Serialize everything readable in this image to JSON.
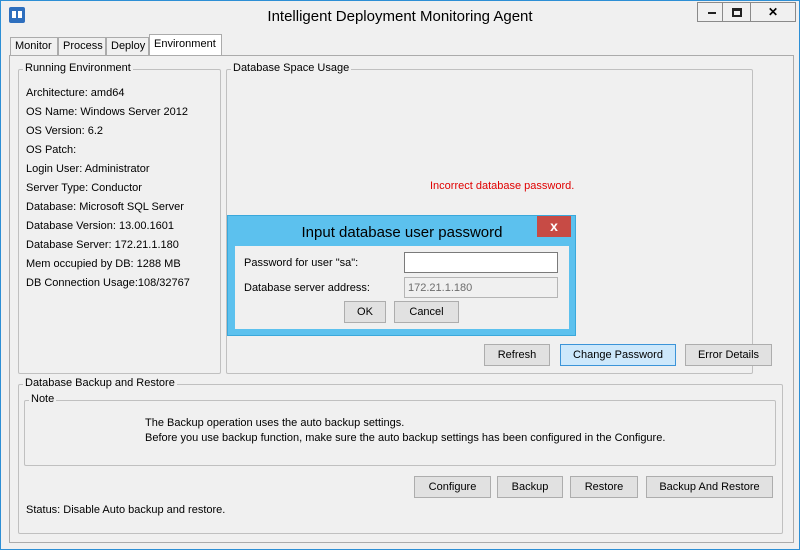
{
  "window": {
    "title": "Intelligent Deployment Monitoring Agent"
  },
  "tabs": [
    {
      "label": "Monitor"
    },
    {
      "label": "Process"
    },
    {
      "label": "Deploy"
    },
    {
      "label": "Environment",
      "active": true
    }
  ],
  "running_env": {
    "title": "Running Environment",
    "lines": [
      "Architecture: amd64",
      "OS Name: Windows Server 2012",
      "OS Version: 6.2",
      "OS Patch:",
      "Login User: Administrator",
      "Server Type: Conductor",
      "Database: Microsoft SQL Server",
      "Database Version: 13.00.1601",
      "Database Server: 172.21.1.180",
      "Mem occupied by DB: 1288 MB",
      "DB Connection Usage:108/32767"
    ]
  },
  "db_space": {
    "title": "Database Space Usage",
    "error": "Incorrect database password.",
    "buttons": {
      "refresh": "Refresh",
      "change_password": "Change Password",
      "error_details": "Error Details"
    }
  },
  "backup": {
    "title": "Database Backup and Restore",
    "note_title": "Note",
    "note_lines": [
      "The Backup operation uses the auto backup settings.",
      "Before you use backup function, make sure the auto backup settings has been configured in the Configure."
    ],
    "buttons": {
      "configure": "Configure",
      "backup": "Backup",
      "restore": "Restore",
      "backup_and_restore": "Backup And Restore"
    },
    "status": "Status: Disable Auto backup and restore."
  },
  "dialog": {
    "title": "Input database user password",
    "close": "x",
    "password_label": "Password for user \"sa\":",
    "password_value": "",
    "address_label": "Database server address:",
    "address_value": "172.21.1.180",
    "ok": "OK",
    "cancel": "Cancel"
  },
  "colors": {
    "dialog_frame": "#5cc1ee",
    "error_text": "#e00000",
    "close_button": "#c74b45"
  }
}
